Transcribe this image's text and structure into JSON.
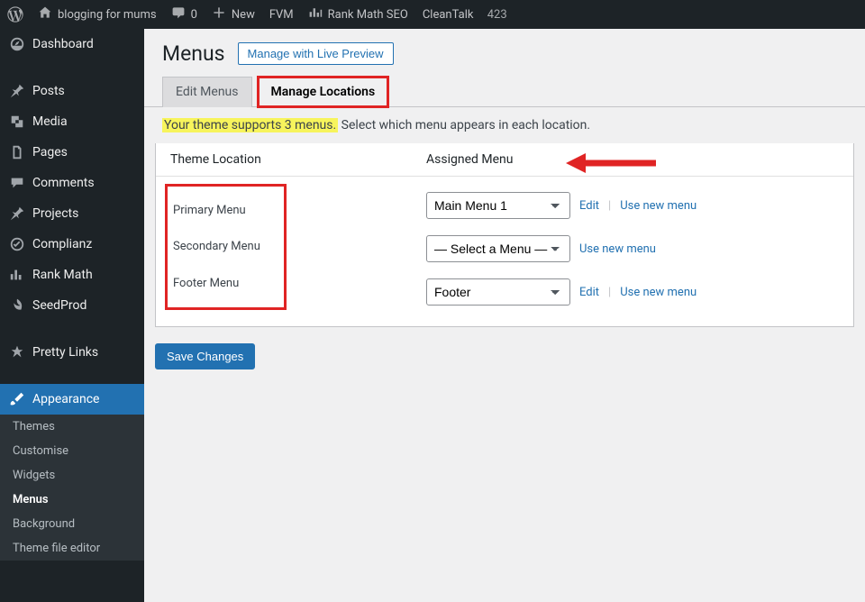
{
  "topbar": {
    "site_name": "blogging for mums",
    "comment_count": "0",
    "new_label": "New",
    "fvm_label": "FVM",
    "rankmath_label": "Rank Math SEO",
    "cleantalk_label": "CleanTalk",
    "cleantalk_count": "423"
  },
  "sidebar": {
    "items": [
      {
        "label": "Dashboard"
      },
      {
        "label": "Posts"
      },
      {
        "label": "Media"
      },
      {
        "label": "Pages"
      },
      {
        "label": "Comments"
      },
      {
        "label": "Projects"
      },
      {
        "label": "Complianz"
      },
      {
        "label": "Rank Math"
      },
      {
        "label": "SeedProd"
      },
      {
        "label": "Pretty Links"
      },
      {
        "label": "Appearance"
      }
    ],
    "submenu": {
      "items": [
        {
          "label": "Themes"
        },
        {
          "label": "Customise"
        },
        {
          "label": "Widgets"
        },
        {
          "label": "Menus"
        },
        {
          "label": "Background"
        },
        {
          "label": "Theme file editor"
        }
      ]
    }
  },
  "page": {
    "title": "Menus",
    "live_preview_btn": "Manage with Live Preview",
    "tabs": {
      "edit": "Edit Menus",
      "manage": "Manage Locations"
    },
    "notice_highlight": "Your theme supports 3 menus.",
    "notice_rest": " Select which menu appears in each location.",
    "table": {
      "col1": "Theme Location",
      "col2": "Assigned Menu",
      "rows": [
        {
          "location": "Primary Menu",
          "selected": "Main Menu 1",
          "edit": "Edit",
          "new": "Use new menu"
        },
        {
          "location": "Secondary Menu",
          "selected": "— Select a Menu —",
          "new": "Use new menu"
        },
        {
          "location": "Footer Menu",
          "selected": "Footer",
          "edit": "Edit",
          "new": "Use new menu"
        }
      ]
    },
    "save_btn": "Save Changes"
  }
}
